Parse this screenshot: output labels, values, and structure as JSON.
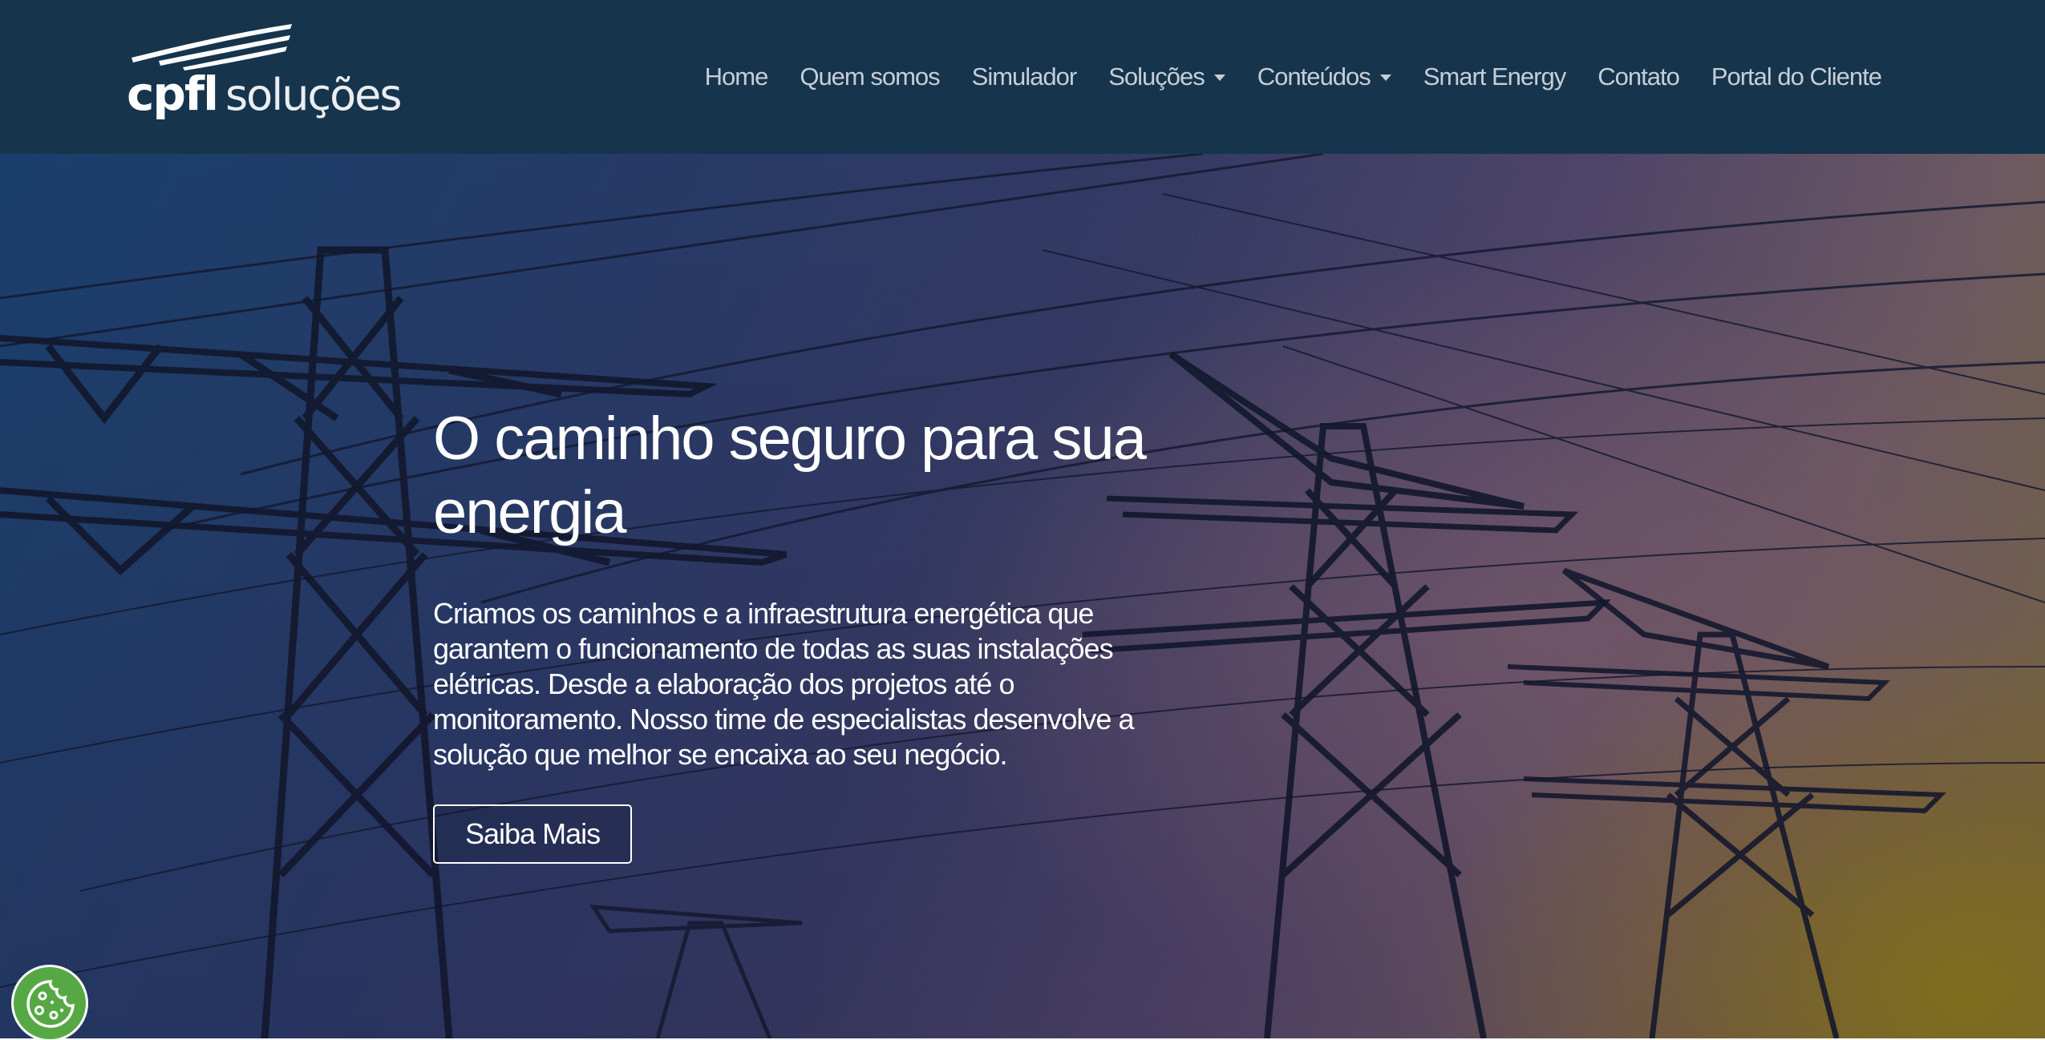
{
  "brand": {
    "name": "cpfl",
    "suffix": "soluções"
  },
  "nav": {
    "items": [
      {
        "label": "Home",
        "dropdown": false
      },
      {
        "label": "Quem somos",
        "dropdown": false
      },
      {
        "label": "Simulador",
        "dropdown": false
      },
      {
        "label": "Soluções",
        "dropdown": true
      },
      {
        "label": "Conteúdos",
        "dropdown": true
      },
      {
        "label": "Smart Energy",
        "dropdown": false
      },
      {
        "label": "Contato",
        "dropdown": false
      },
      {
        "label": "Portal do Cliente",
        "dropdown": false
      }
    ]
  },
  "hero": {
    "title": "O caminho seguro para sua energia",
    "description": "Criamos os caminhos e a infraestrutura energética que garantem o funcionamento de todas as suas instalações elétricas. Desde a elaboração dos projetos até o monitoramento. Nosso time de especialistas desenvolve a solução que melhor se encaixa ao seu negócio.",
    "button_label": "Saiba Mais"
  },
  "cookie": {
    "icon": "cookie-icon"
  },
  "colors": {
    "header_bg": "#17344d",
    "nav_text": "#c6ced6",
    "cookie_green": "#56a845"
  }
}
